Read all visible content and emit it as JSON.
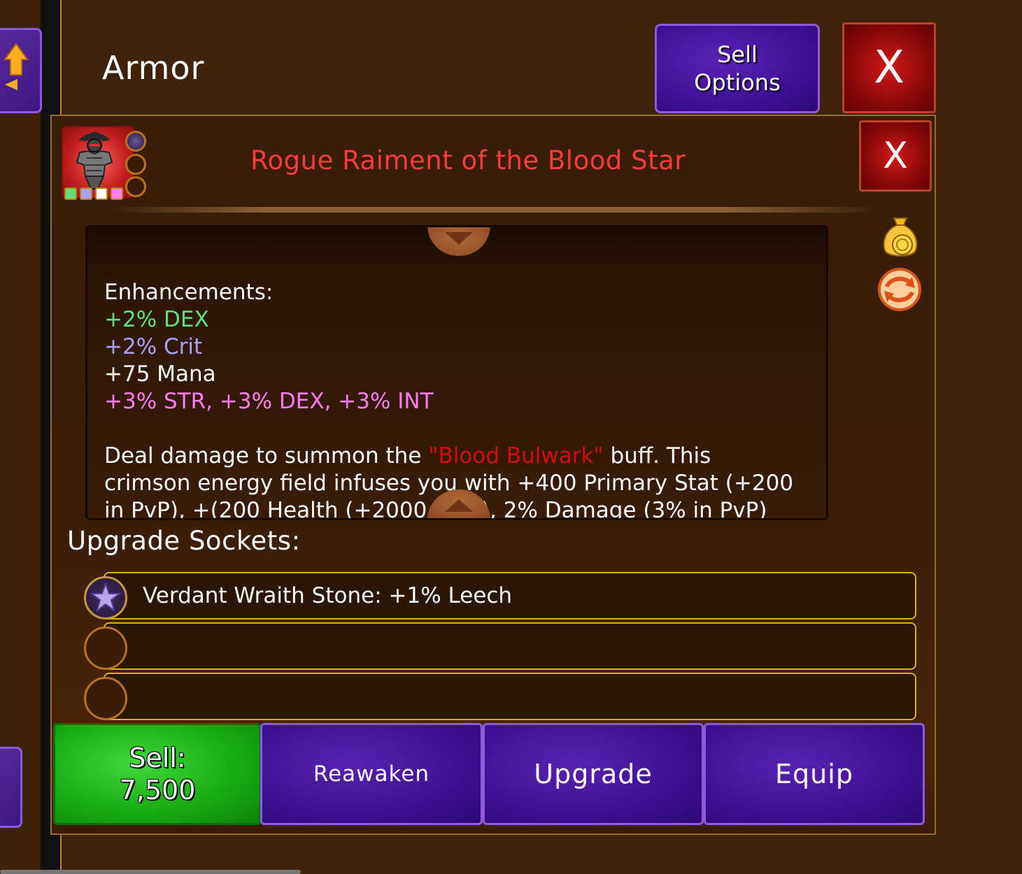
{
  "window": {
    "title": "Armor"
  },
  "header": {
    "sell_options_label": "Sell\nOptions",
    "close_label": "X"
  },
  "item": {
    "name": "Rogue Raiment of the Blood Star",
    "close_label": "X",
    "rarity_colors": [
      "#5fe07a",
      "#a9a0ff",
      "#ffffff",
      "#ff7cf2"
    ],
    "name_color": "#ff3b3b"
  },
  "description": {
    "enhancements_heading": "Enhancements:",
    "enhancements": [
      {
        "text": "+2% DEX",
        "color": "#5fe07a"
      },
      {
        "text": "+2% Crit",
        "color": "#a9a0ff"
      },
      {
        "text": "+75 Mana",
        "color": "#ffffff"
      },
      {
        "text": "+3% STR, +3% DEX, +3% INT",
        "color": "#ff7cf2"
      }
    ],
    "effect_prefix": "Deal damage to summon the ",
    "effect_name": "\"Blood Bulwark\"",
    "effect_suffix": " buff. This",
    "effect_line2": "crimson energy field infuses you with +400 Primary Stat (+200",
    "effect_line3_partial": "in PvP), +(200 Health (+2000 in ...), 2% Damage (3% in PvP)"
  },
  "sockets": {
    "heading": "Upgrade Sockets:",
    "rows": [
      {
        "text": "Verdant Wraith Stone: +1% Leech",
        "filled": true
      },
      {
        "text": "",
        "filled": false
      },
      {
        "text": "",
        "filled": false
      }
    ]
  },
  "actions": {
    "sell_label": "Sell:\n7,500",
    "reawaken_label": "Reawaken",
    "upgrade_label": "Upgrade",
    "equip_label": "Equip"
  },
  "icons": {
    "side_icons": [
      "gold-bag-icon",
      "reroll-icon"
    ],
    "nav_icon": "up-arrow-icon"
  }
}
